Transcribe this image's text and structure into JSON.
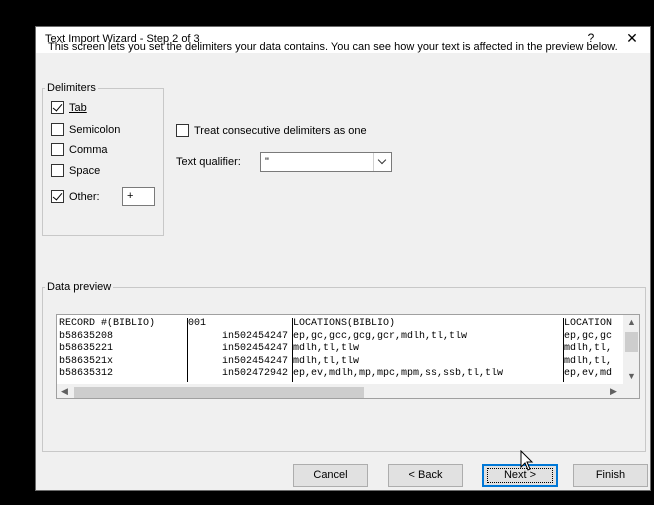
{
  "dialog": {
    "title": "Text Import Wizard - Step 2 of 3",
    "help_label": "?",
    "close_label": "✕",
    "intro": "This screen lets you set the delimiters your data contains.  You can see how your text is affected in the preview below."
  },
  "delimiters": {
    "group_label": "Delimiters",
    "tab": {
      "label": "Tab",
      "checked": true
    },
    "semicolon": {
      "label": "Semicolon",
      "checked": false
    },
    "comma": {
      "label": "Comma",
      "checked": false
    },
    "space": {
      "label": "Space",
      "checked": false
    },
    "other": {
      "label": "Other:",
      "checked": true,
      "value": "+"
    }
  },
  "consecutive": {
    "label": "Treat consecutive delimiters as one",
    "checked": false
  },
  "qualifier": {
    "label": "Text qualifier:",
    "value": "\""
  },
  "preview": {
    "group_label": "Data preview",
    "rows": [
      [
        "RECORD #(BIBLIO)",
        "001",
        "LOCATIONS(BIBLIO)",
        "LOCATION"
      ],
      [
        "b58635208",
        "in502454247",
        "ep,gc,gcc,gcg,gcr,mdlh,tl,tlw",
        "ep,gc,gc"
      ],
      [
        "b58635221",
        "in502454247",
        "mdlh,tl,tlw",
        "mdlh,tl,"
      ],
      [
        "b5863521x",
        "in502454247",
        "mdlh,tl,tlw",
        "mdlh,tl,"
      ],
      [
        "b58635312",
        "in502472942",
        "ep,ev,mdlh,mp,mpc,mpm,ss,ssb,tl,tlw",
        "ep,ev,md"
      ]
    ]
  },
  "buttons": {
    "cancel": "Cancel",
    "back": "< Back",
    "next": "Next >",
    "finish": "Finish"
  }
}
